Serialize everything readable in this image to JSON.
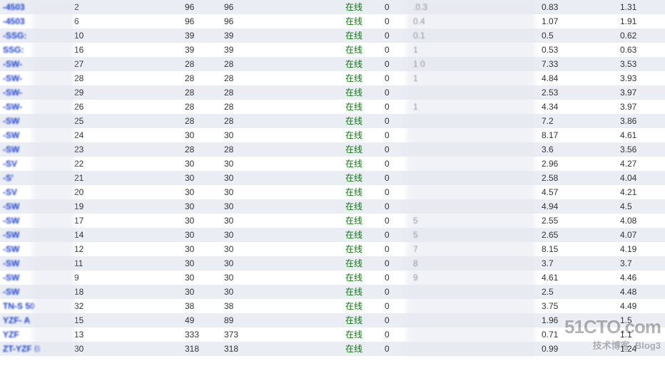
{
  "watermark": {
    "site": "51CTO.com",
    "tagline": "技术博客",
    "sub": "Blog3"
  },
  "status_online": "在线",
  "rows": [
    {
      "name": "-4503",
      "c2": "2",
      "c3": "96",
      "c4": "96",
      "c6": "0",
      "c7": ".0.3",
      "c8": "0.83",
      "c9": "1.31"
    },
    {
      "name": "-4503",
      "c2": "6",
      "c3": "96",
      "c4": "96",
      "c6": "0",
      "c7": "0.4",
      "c8": "1.07",
      "c9": "1.91"
    },
    {
      "name": "-SSG:",
      "c2": "10",
      "c3": "39",
      "c4": "39",
      "c6": "0",
      "c7": "0.1",
      "c8": "0.5",
      "c9": "0.62"
    },
    {
      "name": "SSG:",
      "c2": "16",
      "c3": "39",
      "c4": "39",
      "c6": "0",
      "c7": "1",
      "c8": "0.53",
      "c9": "0.63"
    },
    {
      "name": "-SW-",
      "c2": "27",
      "c3": "28",
      "c4": "28",
      "c6": "0",
      "c7": "1  0",
      "c8": "7.33",
      "c9": "3.53"
    },
    {
      "name": "-SW-",
      "c2": "28",
      "c3": "28",
      "c4": "28",
      "c6": "0",
      "c7": "1",
      "c8": "4.84",
      "c9": "3.93"
    },
    {
      "name": "-SW-",
      "c2": "29",
      "c3": "28",
      "c4": "28",
      "c6": "0",
      "c7": "",
      "c8": "2.53",
      "c9": "3.97"
    },
    {
      "name": "-SW-",
      "c2": "26",
      "c3": "28",
      "c4": "28",
      "c6": "0",
      "c7": "1",
      "c8": "4.34",
      "c9": "3.97"
    },
    {
      "name": "-SW",
      "c2": "25",
      "c3": "28",
      "c4": "28",
      "c6": "0",
      "c7": "",
      "c8": "7.2",
      "c9": "3.86"
    },
    {
      "name": "-SW",
      "c2": "24",
      "c3": "30",
      "c4": "30",
      "c6": "0",
      "c7": "",
      "c8": "8.17",
      "c9": "4.61"
    },
    {
      "name": "-SW",
      "c2": "23",
      "c3": "28",
      "c4": "28",
      "c6": "0",
      "c7": "",
      "c8": "3.6",
      "c9": "3.56"
    },
    {
      "name": "-SV",
      "c2": "22",
      "c3": "30",
      "c4": "30",
      "c6": "0",
      "c7": "",
      "c8": "2.96",
      "c9": "4.27"
    },
    {
      "name": "-S'",
      "c2": "21",
      "c3": "30",
      "c4": "30",
      "c6": "0",
      "c7": "",
      "c8": "2.58",
      "c9": "4.04"
    },
    {
      "name": "-SV",
      "c2": "20",
      "c3": "30",
      "c4": "30",
      "c6": "0",
      "c7": "",
      "c8": "4.57",
      "c9": "4.21"
    },
    {
      "name": "-SW",
      "c2": "19",
      "c3": "30",
      "c4": "30",
      "c6": "0",
      "c7": "",
      "c8": "4.94",
      "c9": "4.5"
    },
    {
      "name": "-SW",
      "c2": "17",
      "c3": "30",
      "c4": "30",
      "c6": "0",
      "c7": "5",
      "c8": "2.55",
      "c9": "4.08"
    },
    {
      "name": "-SW",
      "c2": "14",
      "c3": "30",
      "c4": "30",
      "c6": "0",
      "c7": "5",
      "c8": "2.65",
      "c9": "4.07"
    },
    {
      "name": "-SW",
      "c2": "12",
      "c3": "30",
      "c4": "30",
      "c6": "0",
      "c7": "7",
      "c8": "8.15",
      "c9": "4.19"
    },
    {
      "name": "-SW",
      "c2": "11",
      "c3": "30",
      "c4": "30",
      "c6": "0",
      "c7": "8",
      "c8": "3.7",
      "c9": "3.7"
    },
    {
      "name": "-SW",
      "c2": "9",
      "c3": "30",
      "c4": "30",
      "c6": "0",
      "c7": "9",
      "c8": "4.61",
      "c9": "4.46"
    },
    {
      "name": "-SW",
      "c2": "18",
      "c3": "30",
      "c4": "30",
      "c6": "0",
      "c7": "",
      "c8": "2.5",
      "c9": "4.48"
    },
    {
      "name": "TN-S  50",
      "c2": "32",
      "c3": "38",
      "c4": "38",
      "c6": "0",
      "c7": "",
      "c8": "3.75",
      "c9": "4.49"
    },
    {
      "name": "YZF-   A",
      "c2": "15",
      "c3": "49",
      "c4": "89",
      "c6": "0",
      "c7": "",
      "c8": "1.96",
      "c9": "1.5"
    },
    {
      "name": "YZF",
      "c2": "13",
      "c3": "333",
      "c4": "373",
      "c6": "0",
      "c7": "",
      "c8": "0.71",
      "c9": "1.1"
    },
    {
      "name": "ZT-YZF  B",
      "c2": "30",
      "c3": "318",
      "c4": "318",
      "c6": "0",
      "c7": "",
      "c8": "0.99",
      "c9": "1.24"
    }
  ]
}
